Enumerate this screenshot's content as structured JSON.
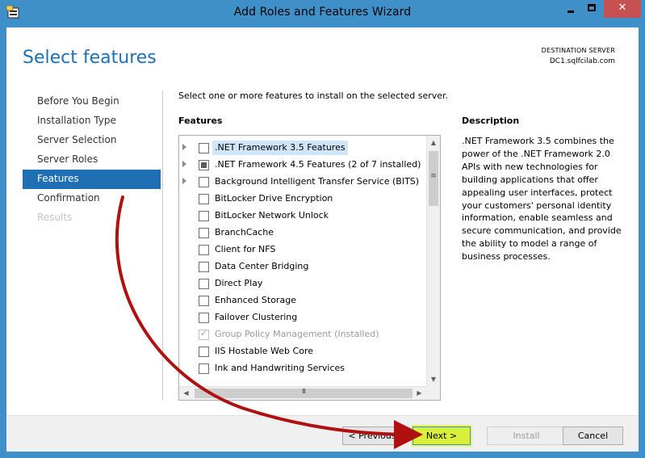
{
  "window": {
    "title": "Add Roles and Features Wizard",
    "minimize": "—",
    "maximize": "□",
    "close": "✕"
  },
  "header": {
    "page_title": "Select features",
    "destination_label": "DESTINATION SERVER",
    "destination_server": "DC1.sqlfcilab.com"
  },
  "nav": {
    "items": [
      {
        "label": "Before You Begin",
        "state": "normal"
      },
      {
        "label": "Installation Type",
        "state": "normal"
      },
      {
        "label": "Server Selection",
        "state": "normal"
      },
      {
        "label": "Server Roles",
        "state": "normal"
      },
      {
        "label": "Features",
        "state": "active"
      },
      {
        "label": "Confirmation",
        "state": "normal"
      },
      {
        "label": "Results",
        "state": "disabled"
      }
    ]
  },
  "main": {
    "instruction": "Select one or more features to install on the selected server.",
    "features_heading": "Features",
    "features": [
      {
        "label": ".NET Framework 3.5 Features",
        "expandable": true,
        "check": "unchecked",
        "selected": true
      },
      {
        "label": ".NET Framework 4.5 Features (2 of 7 installed)",
        "expandable": true,
        "check": "partial",
        "selected": false
      },
      {
        "label": "Background Intelligent Transfer Service (BITS)",
        "expandable": true,
        "check": "unchecked",
        "selected": false
      },
      {
        "label": "BitLocker Drive Encryption",
        "expandable": false,
        "check": "unchecked",
        "selected": false
      },
      {
        "label": "BitLocker Network Unlock",
        "expandable": false,
        "check": "unchecked",
        "selected": false
      },
      {
        "label": "BranchCache",
        "expandable": false,
        "check": "unchecked",
        "selected": false
      },
      {
        "label": "Client for NFS",
        "expandable": false,
        "check": "unchecked",
        "selected": false
      },
      {
        "label": "Data Center Bridging",
        "expandable": false,
        "check": "unchecked",
        "selected": false
      },
      {
        "label": "Direct Play",
        "expandable": false,
        "check": "unchecked",
        "selected": false
      },
      {
        "label": "Enhanced Storage",
        "expandable": false,
        "check": "unchecked",
        "selected": false
      },
      {
        "label": "Failover Clustering",
        "expandable": false,
        "check": "unchecked",
        "selected": false
      },
      {
        "label": "Group Policy Management (Installed)",
        "expandable": false,
        "check": "checked-disabled",
        "selected": false
      },
      {
        "label": "IIS Hostable Web Core",
        "expandable": false,
        "check": "unchecked",
        "selected": false
      },
      {
        "label": "Ink and Handwriting Services",
        "expandable": false,
        "check": "unchecked",
        "selected": false
      }
    ],
    "scroll": {
      "up": "▲",
      "down": "▼",
      "left": "◀",
      "right": "▶",
      "vgrip": "≡",
      "hgrip": "III"
    }
  },
  "description": {
    "heading": "Description",
    "text": ".NET Framework 3.5 combines the power of the .NET Framework 2.0 APIs with new technologies for building applications that offer appealing user interfaces, protect your customers' personal identity information, enable seamless and secure communication, and provide the ability to model a range of business processes."
  },
  "buttons": {
    "previous": "< Previous",
    "next": "Next >",
    "install": "Install",
    "cancel": "Cancel"
  },
  "colors": {
    "accent": "#1e6fb4",
    "titlebar": "#3f8fc9",
    "next_highlight": "#d8f03a",
    "annotation_arrow": "#b01010"
  }
}
